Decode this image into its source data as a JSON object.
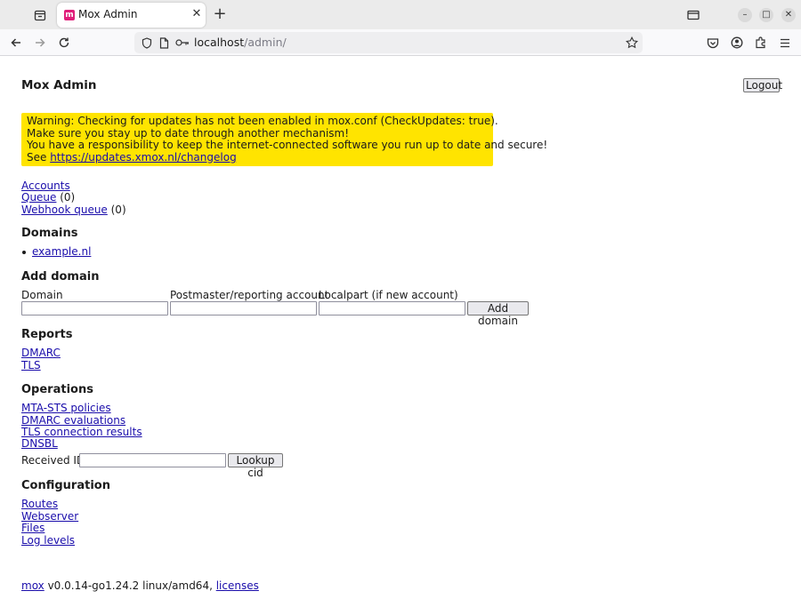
{
  "browser": {
    "tab_title": "Mox Admin",
    "url_host": "localhost",
    "url_path": "/admin/"
  },
  "page": {
    "title": "Mox Admin",
    "logout_label": "Logout",
    "warning": {
      "line1": "Warning: Checking for updates has not been enabled in mox.conf (CheckUpdates: true).",
      "line2": "Make sure you stay up to date through another mechanism!",
      "line3": "You have a responsibility to keep the internet-connected software you run up to date and secure!",
      "line4_prefix": "See ",
      "line4_link": "https://updates.xmox.nl/changelog"
    },
    "nav": {
      "accounts": "Accounts",
      "queue": "Queue",
      "queue_count": " (0)",
      "webhook_queue": "Webhook queue",
      "webhook_count": " (0)"
    },
    "domains": {
      "heading": "Domains",
      "items": [
        "example.nl"
      ]
    },
    "add_domain": {
      "heading": "Add domain",
      "domain_label": "Domain",
      "postmaster_label": "Postmaster/reporting account",
      "localpart_label": "Localpart (if new account)",
      "domain_value": "",
      "postmaster_value": "",
      "localpart_value": "",
      "button": "Add domain"
    },
    "reports": {
      "heading": "Reports",
      "dmarc": "DMARC",
      "tls": "TLS"
    },
    "operations": {
      "heading": "Operations",
      "mta_sts": "MTA-STS policies",
      "dmarc_eval": "DMARC evaluations",
      "tls_results": "TLS connection results",
      "dnsbl": "DNSBL",
      "received_id_label": "Received ID",
      "received_id_value": "",
      "lookup_button": "Lookup cid"
    },
    "configuration": {
      "heading": "Configuration",
      "routes": "Routes",
      "webserver": "Webserver",
      "files": "Files",
      "log_levels": "Log levels"
    },
    "footer": {
      "mox_link": "mox",
      "version": " v0.0.14-go1.24.2 linux/amd64, ",
      "licenses": "licenses"
    }
  }
}
